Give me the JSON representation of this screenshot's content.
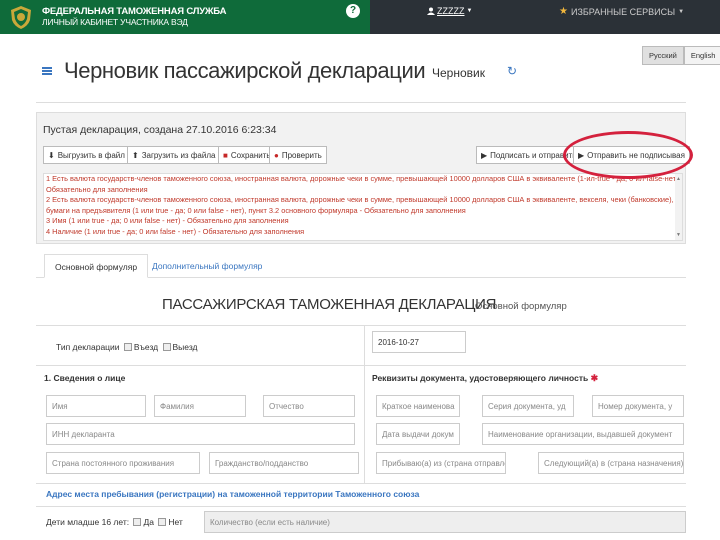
{
  "header": {
    "org_title": "ФЕДЕРАЛЬНАЯ ТАМОЖЕННАЯ СЛУЖБА",
    "org_subtitle": "ЛИЧНЫЙ КАБИНЕТ УЧАСТНИКА ВЭД",
    "help_label": "?",
    "user_name": "ZZZZZ",
    "services_label": "ИЗБРАННЫЕ СЕРВИСЫ",
    "brand_color": "#0f6b3a",
    "bar_color": "#2b3137"
  },
  "language": {
    "items": [
      "Русский",
      "English"
    ]
  },
  "page": {
    "title": "Черновик пассажирской декларации",
    "status": "Черновик"
  },
  "panel": {
    "header": "Пустая декларация, создана 27.10.2016 6:23:34",
    "buttons": {
      "export": "Выгрузить в файл",
      "import": "Загрузить из файла",
      "save": "Сохранить",
      "check": "Проверить",
      "sign_send": "Подписать и отправить",
      "send_unsigned": "Отправить не подписывая"
    },
    "messages": [
      "1 Есть валюта государств-членов таможенного союза, иностранная валюта, дорожные чеки в сумме, превышающей 10000 долларов США в эквиваленте (1-ил-true - да; 0-ил-false-нет) -",
      "Обязательно для заполнения",
      "2 Есть валюта государств-членов таможенного союза, иностранная валюта, дорожные чеки в сумме, превышающей 10000 долларов США в эквиваленте, векселя, чеки (банковские), ценные",
      "бумаги на предъявителя (1 или true - да; 0 или false - нет), пункт 3.2 основного формуляра - Обязательно для заполнения",
      "3 Имя (1 или true - да; 0 или false - нет) - Обязательно для заполнения",
      "4 Наличие (1 или true - да; 0 или false - нет) - Обязательно для заполнения"
    ],
    "accent_color": "#d4213d"
  },
  "tabs": {
    "main": "Основной формуляр",
    "additional": "Дополнительный формуляр"
  },
  "form": {
    "title": "ПАССАЖИРСКАЯ ТАМОЖЕННАЯ ДЕКЛАРАЦИЯ",
    "subtitle": "Основной формуляр",
    "decl_type_label": "Тип декларации",
    "entry_label": "Въезд",
    "exit_label": "Выезд",
    "date_value": "2016-10-27",
    "section1_title": "1. Сведения о лице",
    "doc_section_title": "Реквизиты документа, удостоверяющего личность",
    "required_mark": "✱",
    "placeholders": {
      "first_name": "Имя",
      "last_name": "Фамилия",
      "patronymic": "Отчество",
      "doc_name": "Краткое наименова",
      "doc_series": "Серия документа, уд",
      "doc_number": "Номер документа, у",
      "inn": "ИНН декларанта",
      "issue_date": "Дата выдачи докум",
      "issuer": "Наименование организации, выдавшей документ",
      "residence_country": "Страна постоянного проживания",
      "citizenship": "Гражданство/подданство",
      "arrival_from": "Прибываю(а) из (страна отправления)",
      "next_to": "Следующий(а) в (страна назначения)",
      "children_count": "Количество (если есть наличие)"
    },
    "address_link": "Адрес места пребывания (регистрации) на таможенной территории Таможенного союза",
    "children_label": "Дети младше 16 лет:",
    "yes_label": "Да",
    "no_label": "Нет"
  }
}
